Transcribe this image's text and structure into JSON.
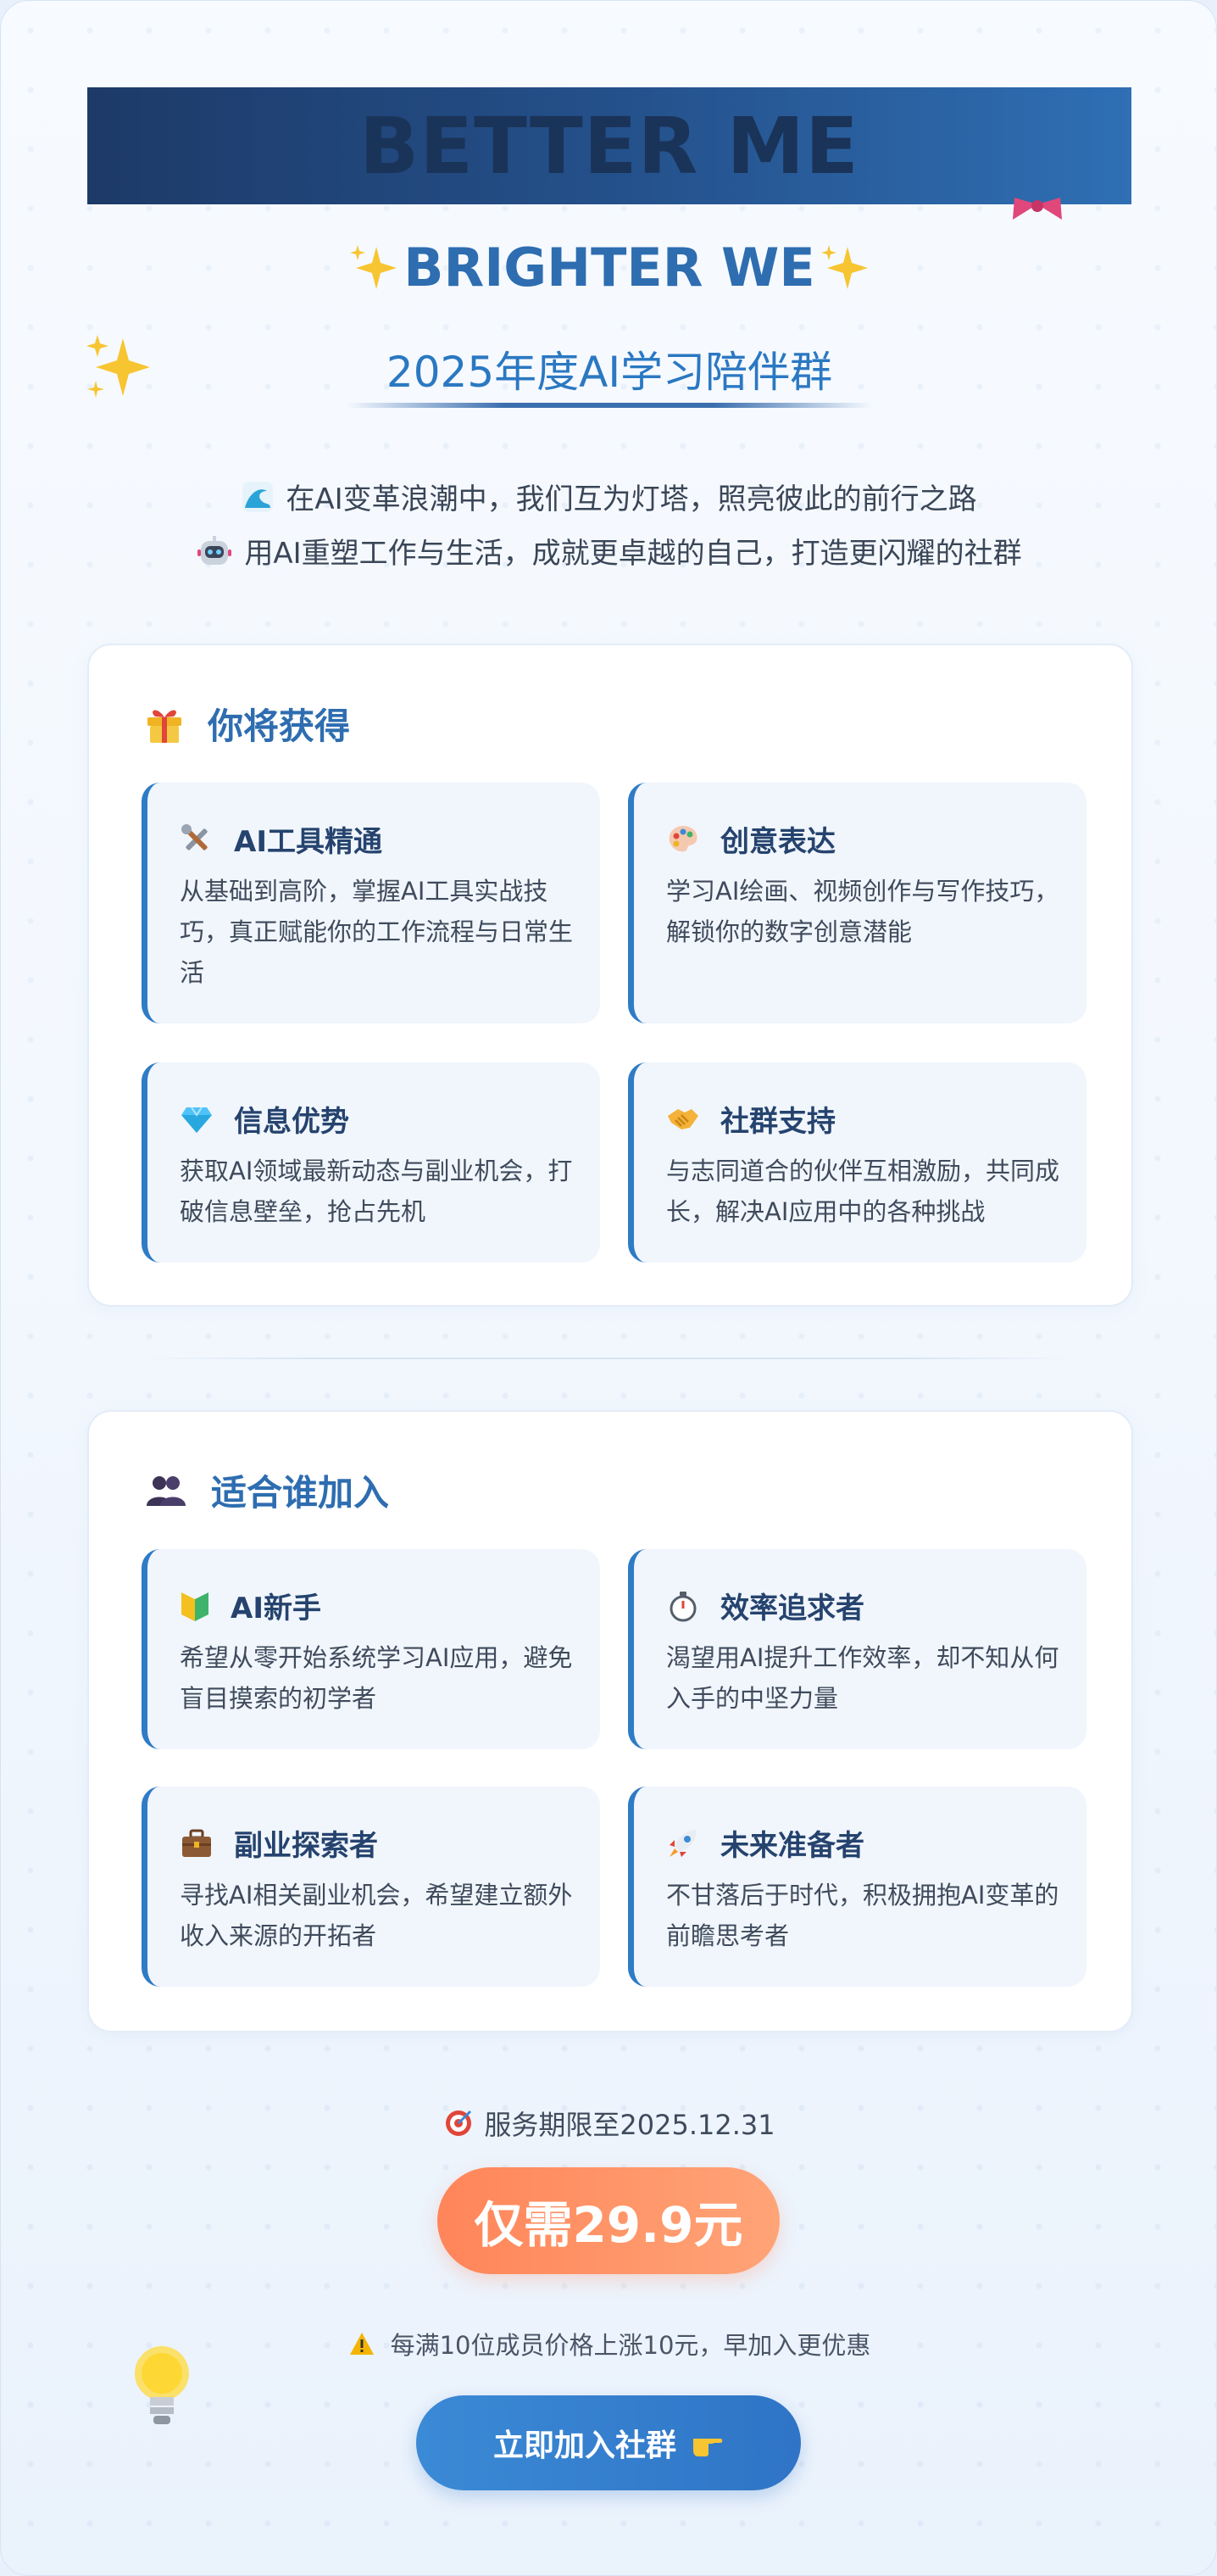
{
  "banner": {
    "title": "BETTER ME"
  },
  "subtitle": "BRIGHTER WE",
  "group_name": "2025年度AI学习陪伴群",
  "intro": [
    "在AI变革浪潮中，我们互为灯塔，照亮彼此的前行之路",
    "用AI重塑工作与生活，成就更卓越的自己，打造更闪耀的社群"
  ],
  "benefits": {
    "title": "你将获得",
    "items": [
      {
        "icon": "tools-icon",
        "title": "AI工具精通",
        "desc": "从基础到高阶，掌握AI工具实战技巧，真正赋能你的工作流程与日常生活"
      },
      {
        "icon": "palette-icon",
        "title": "创意表达",
        "desc": "学习AI绘画、视频创作与写作技巧，解锁你的数字创意潜能"
      },
      {
        "icon": "gem-icon",
        "title": "信息优势",
        "desc": "获取AI领域最新动态与副业机会，打破信息壁垒，抢占先机"
      },
      {
        "icon": "handshake-icon",
        "title": "社群支持",
        "desc": "与志同道合的伙伴互相激励，共同成长，解决AI应用中的各种挑战"
      }
    ]
  },
  "audience": {
    "title": "适合谁加入",
    "items": [
      {
        "icon": "beginner-icon",
        "title": "AI新手",
        "desc": "希望从零开始系统学习AI应用，避免盲目摸索的初学者"
      },
      {
        "icon": "stopwatch-icon",
        "title": "效率追求者",
        "desc": "渴望用AI提升工作效率，却不知从何入手的中坚力量"
      },
      {
        "icon": "briefcase-icon",
        "title": "副业探索者",
        "desc": "寻找AI相关副业机会，希望建立额外收入来源的开拓者"
      },
      {
        "icon": "rocket-icon",
        "title": "未来准备者",
        "desc": "不甘落后于时代，积极拥抱AI变革的前瞻思考者"
      }
    ]
  },
  "deadline": "服务期限至2025.12.31",
  "price": "仅需29.9元",
  "warning": "每满10位成员价格上涨10元，早加入更优惠",
  "join_button": "立即加入社群",
  "colors": {
    "primary": "#2e6db0",
    "banner_dark": "#1d3a68",
    "accent_orange": "#ff8559",
    "button_blue": "#2f74c6"
  }
}
